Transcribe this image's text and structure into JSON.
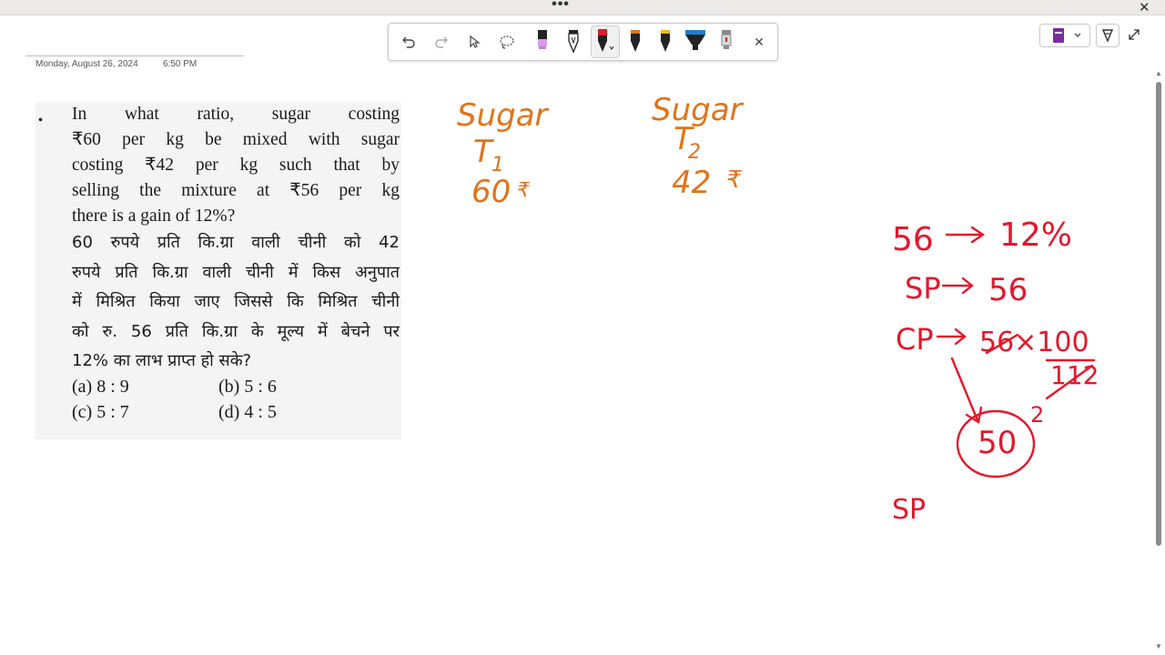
{
  "titlebar": {
    "more_glyph": "•••",
    "close_glyph": "✕"
  },
  "page": {
    "date": "Monday, August 26, 2024",
    "time": "6:50 PM"
  },
  "toolbar": {
    "tools": [
      "undo",
      "redo",
      "select",
      "lasso",
      "pen-purple",
      "pen-black",
      "pen-red",
      "pen-orange",
      "pen-yellow",
      "highlighter-blue",
      "pen-gray"
    ],
    "selected": "pen-red",
    "close_glyph": "✕"
  },
  "colors": {
    "ink_orange": "#e0741a",
    "ink_red": "#e2182c",
    "toolbar_border": "#c8c8c8"
  },
  "question": {
    "bullet": ".",
    "english_lines": [
      "In what ratio, sugar costing",
      "₹60 per kg be mixed with sugar",
      "costing ₹42 per kg such that by",
      "selling the mixture at ₹56 per kg",
      "there is a gain of 12%?"
    ],
    "hindi_lines": [
      "60 रुपये प्रति कि.ग्रा वाली चीनी को 42",
      "रुपये प्रति कि.ग्रा वाली चीनी में किस अनुपात",
      "में मिश्रित किया जाए जिससे कि मिश्रित चीनी",
      "को रु. 56 प्रति कि.ग्रा के मूल्य में बेचने पर",
      "12% का लाभ प्राप्त हो सके?"
    ],
    "options": {
      "a": "(a) 8 : 9",
      "b": "(b) 5 : 6",
      "c": "(c) 5 : 7",
      "d": "(d) 4 : 5"
    }
  },
  "ink_orange": {
    "col1": [
      "Sugar",
      "T",
      "1",
      "60",
      "₹"
    ],
    "col2": [
      "Sugar",
      "T",
      "2",
      "42",
      "₹"
    ]
  },
  "ink_red": {
    "line1_left": "56",
    "line1_right": "12%",
    "line2_left": "SP",
    "line2_right": "56",
    "line3_left": "CP",
    "line3_num": "56×100",
    "line3_den": "112",
    "cancel_small": "2",
    "circled": "50",
    "sp_bottom": "SP"
  }
}
